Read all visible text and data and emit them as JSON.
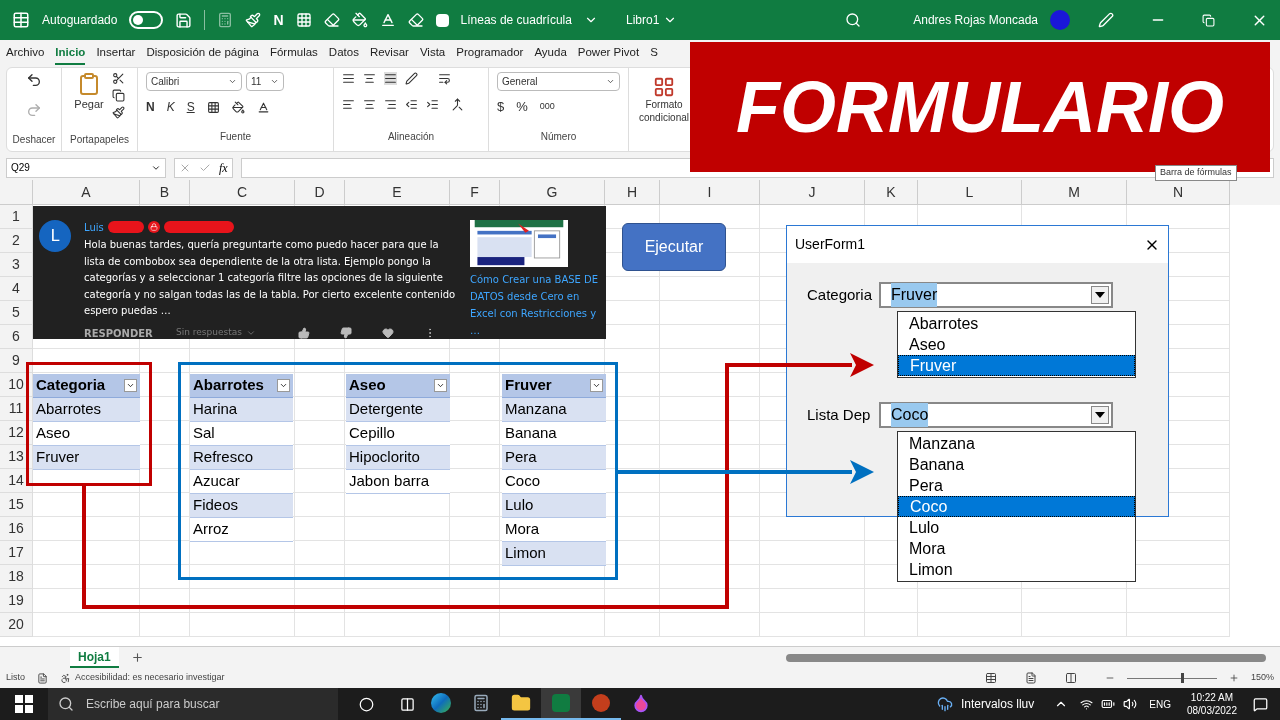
{
  "title_bar": {
    "autosave_label": "Autoguardado",
    "autosave_on": false,
    "quick_bold": "N",
    "gridlines_label": "Líneas de cuadrícula",
    "gridlines_checked": false,
    "workbook": "Libro1",
    "user": "Andres Rojas Moncada"
  },
  "ribbon_tabs": [
    {
      "label": "Archivo",
      "selected": false
    },
    {
      "label": "Inicio",
      "selected": true
    },
    {
      "label": "Insertar",
      "selected": false
    },
    {
      "label": "Disposición de página",
      "selected": false
    },
    {
      "label": "Fórmulas",
      "selected": false
    },
    {
      "label": "Datos",
      "selected": false
    },
    {
      "label": "Revisar",
      "selected": false
    },
    {
      "label": "Vista",
      "selected": false
    },
    {
      "label": "Programador",
      "selected": false
    },
    {
      "label": "Ayuda",
      "selected": false
    },
    {
      "label": "Power Pivot",
      "selected": false
    },
    {
      "label": "S",
      "selected": false
    }
  ],
  "ribbon": {
    "paste": "Pegar",
    "font": "Calibri",
    "size": "11",
    "bold": "N",
    "italic": "K",
    "underline": "S",
    "number_format": "General",
    "currency": "$",
    "percent": "%",
    "thousands": "000",
    "conditional": "Formato condicional",
    "groups": [
      "Deshacer",
      "Portapapeles",
      "Fuente",
      "Alineación",
      "Número"
    ]
  },
  "banner": {
    "title": "FORMULARIO"
  },
  "formula_bar": {
    "name_box": "Q29",
    "fx": "fx"
  },
  "tooltip": "Barra de fórmulas",
  "columns": [
    "A",
    "B",
    "C",
    "D",
    "E",
    "F",
    "G",
    "H",
    "I",
    "J",
    "K",
    "L",
    "M",
    "N"
  ],
  "rows": [
    "1",
    "2",
    "3",
    "4",
    "5",
    "6",
    "9",
    "10",
    "11",
    "12",
    "13",
    "14",
    "15",
    "16",
    "17",
    "18",
    "19",
    "20"
  ],
  "comment": {
    "avatar": "L",
    "author": "Luis",
    "text": "Hola buenas tardes, quería preguntarte como puedo hacer para que la lista de combobox sea dependiente de la otra lista. Ejemplo pongo la categorías y a seleccionar 1 categoría filtre las opciones de la siguiente categoría y no salgan todas las de la tabla. Por cierto excelente contenido espero puedas …",
    "reply": "RESPONDER",
    "replies": "Sin respuestas",
    "video_title": "Cómo Crear una BASE DE DATOS desde Cero en Excel con Restricciones y …"
  },
  "button": "Ejecutar",
  "tables": [
    {
      "header": "Categoria",
      "items": [
        "Abarrotes",
        "Aseo",
        "Fruver"
      ]
    },
    {
      "header": "Abarrotes",
      "items": [
        "Harina",
        "Sal",
        "Refresco",
        "Azucar",
        "Fideos",
        "Arroz"
      ]
    },
    {
      "header": "Aseo",
      "items": [
        "Detergente",
        "Cepillo",
        "Hipoclorito",
        "Jabon barra"
      ]
    },
    {
      "header": "Fruver",
      "items": [
        "Manzana",
        "Banana",
        "Pera",
        "Coco",
        "Lulo",
        "Mora",
        "Limon"
      ]
    }
  ],
  "userform": {
    "title": "UserForm1",
    "fields": [
      {
        "label": "Categoria",
        "value": "Fruver",
        "options": [
          {
            "label": "Abarrotes",
            "selected": false
          },
          {
            "label": "Aseo",
            "selected": false
          },
          {
            "label": "Fruver",
            "selected": true
          }
        ]
      },
      {
        "label": "Lista Dep",
        "value": "Coco",
        "options": [
          {
            "label": "Manzana",
            "selected": false
          },
          {
            "label": "Banana",
            "selected": false
          },
          {
            "label": "Pera",
            "selected": false
          },
          {
            "label": "Coco",
            "selected": true
          },
          {
            "label": "Lulo",
            "selected": false
          },
          {
            "label": "Mora",
            "selected": false
          },
          {
            "label": "Limon",
            "selected": false
          }
        ]
      }
    ]
  },
  "sheet_tabs": [
    {
      "label": "Hoja1",
      "selected": true
    }
  ],
  "status_bar": {
    "ready": "Listo",
    "accessibility": "Accesibilidad: es necesario investigar",
    "zoom": "150%",
    "zoom_slider": {
      "level": 0.6
    }
  },
  "taskbar": {
    "search_placeholder": "Escribe aquí para buscar",
    "apps": [
      {
        "kind": "edge",
        "running": false,
        "selected": false
      },
      {
        "kind": "calculator",
        "running": false,
        "selected": false
      },
      {
        "kind": "folder",
        "running": true,
        "selected": false
      },
      {
        "kind": "excel",
        "running": true,
        "selected": true
      },
      {
        "kind": "powerpoint",
        "running": true,
        "selected": false
      },
      {
        "kind": "drop",
        "running": false,
        "selected": false
      }
    ],
    "weather": "Intervalos lluv",
    "language": "ENG",
    "time": "10:22 AM",
    "date": "08/03/2022"
  }
}
